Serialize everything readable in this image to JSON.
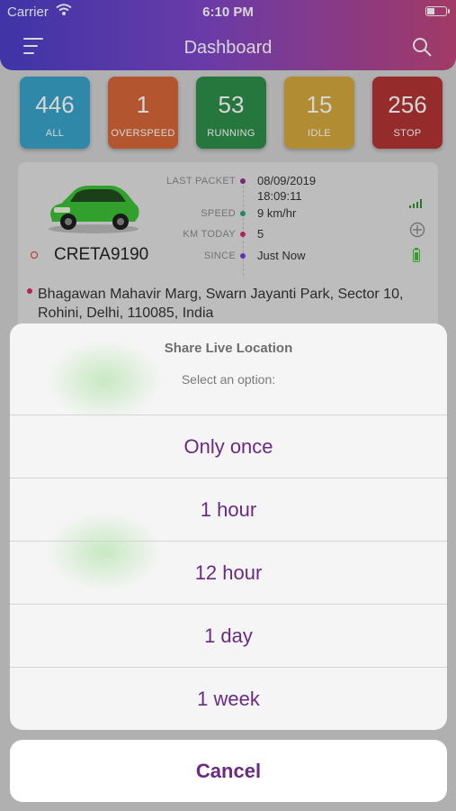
{
  "status_bar": {
    "carrier": "Carrier",
    "time": "6:10 PM",
    "battery_level": 0.35
  },
  "header": {
    "title": "Dashboard"
  },
  "tiles": [
    {
      "count": "446",
      "label": "ALL",
      "color": "#3aa3c9"
    },
    {
      "count": "1",
      "label": "OVERSPEED",
      "color": "#d6673a"
    },
    {
      "count": "53",
      "label": "RUNNING",
      "color": "#2e8e4b"
    },
    {
      "count": "15",
      "label": "IDLE",
      "color": "#d5a73c"
    },
    {
      "count": "256",
      "label": "STOP",
      "color": "#b23434"
    }
  ],
  "vehicle": {
    "name": "CRETA9190",
    "car_color": "#3bbf35",
    "fields": {
      "last_packet_label": "LAST PACKET",
      "last_packet_date": "08/09/2019",
      "last_packet_time": "18:09:11",
      "speed_label": "SPEED",
      "speed_value": "9 km/hr",
      "km_today_label": "KM TODAY",
      "km_today_value": "5",
      "since_label": "SINCE",
      "since_value": "Just Now"
    },
    "address": "Bhagawan Mahavir Marg, Swarn Jayanti Park, Sector 10, Rohini, Delhi, 110085, India"
  },
  "action_sheet": {
    "title": "Share Live Location",
    "message": "Select an option:",
    "options": [
      "Only once",
      "1 hour",
      "12 hour",
      "1 day",
      "1 week"
    ],
    "cancel": "Cancel",
    "accent_color": "#6a2b82"
  }
}
